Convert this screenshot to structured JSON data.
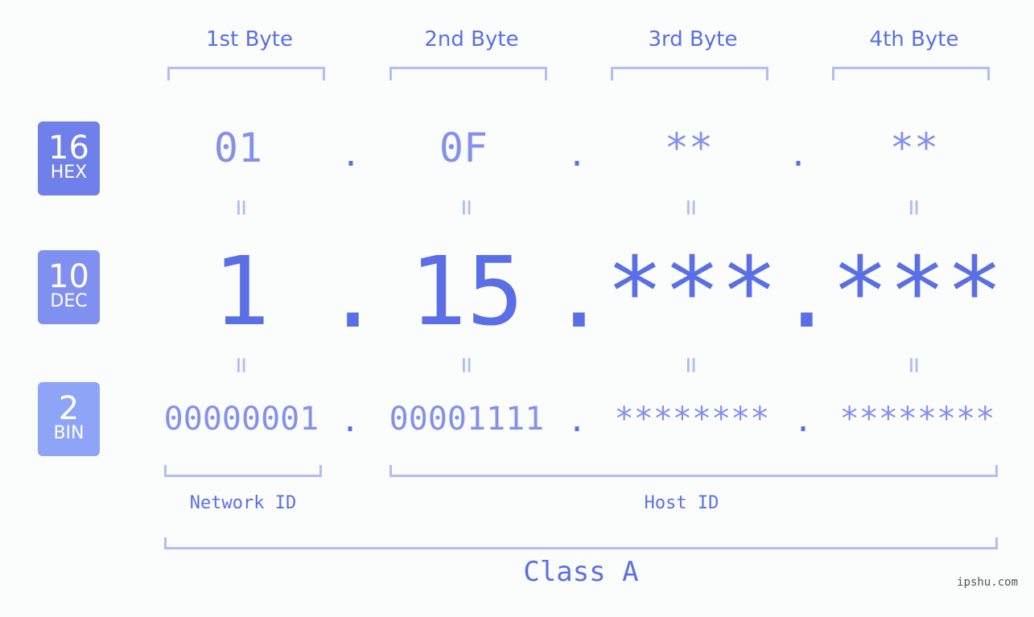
{
  "byte_headers": [
    "1st Byte",
    "2nd Byte",
    "3rd Byte",
    "4th Byte"
  ],
  "rows": {
    "hex": {
      "base": "16",
      "label": "HEX",
      "color": "#7080ea",
      "values": [
        "01",
        "0F",
        "**",
        "**"
      ]
    },
    "dec": {
      "base": "10",
      "label": "DEC",
      "color": "#8090f0",
      "values": [
        "1",
        "15",
        "***",
        "***"
      ]
    },
    "bin": {
      "base": "2",
      "label": "BIN",
      "color": "#8da4f7",
      "values": [
        "00000001",
        "00001111",
        "********",
        "********"
      ]
    }
  },
  "separator": ".",
  "equals": "=",
  "network_label": "Network ID",
  "host_label": "Host ID",
  "class_label": "Class A",
  "watermark": "ipshu.com"
}
